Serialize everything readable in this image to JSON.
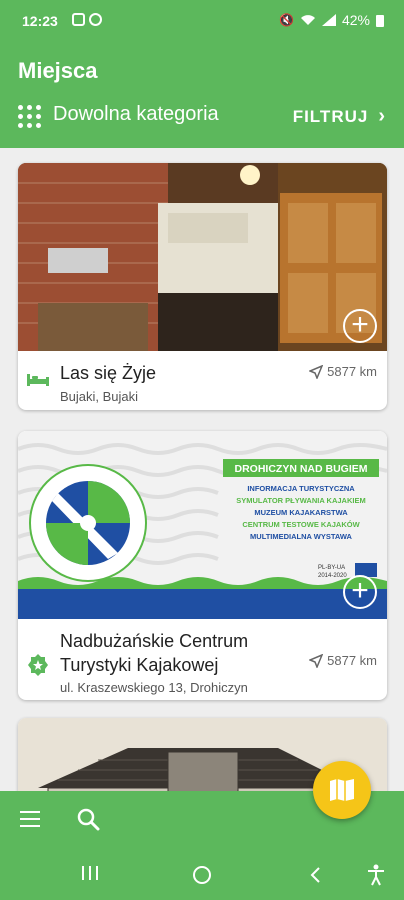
{
  "status": {
    "time": "12:23",
    "battery": "42%"
  },
  "header": {
    "title": "Miejsca",
    "category": "Dowolna kategoria",
    "filter_label": "FILTRUJ"
  },
  "places": [
    {
      "name": "Las się Żyje",
      "address": "Bujaki, Bujaki",
      "distance": "5877 km",
      "type_icon": "bed-icon"
    },
    {
      "name": "Nadbużańskie Centrum Turystyki Kajakowej",
      "address": "ul. Kraszewskiego 13, Drohiczyn",
      "distance": "5877 km",
      "type_icon": "star-badge-icon",
      "poster": {
        "ring_text": "Nadbużańskie Centrum Turystyki Kajakowej",
        "headline": "DROHICZYN NAD BUGIEM",
        "lines": [
          "INFORMACJA TURYSTYCZNA",
          "SYMULATOR PŁYWANIA KAJAKIEM",
          "MUZEUM KAJAKARSTWA",
          "CENTRUM TESTOWE KAJAKÓW",
          "MULTIMEDIALNA WYSTAWA"
        ],
        "program": "PL-BY-UA",
        "years": "2014-2020"
      }
    }
  ],
  "colors": {
    "primary": "#5cb85c",
    "fab": "#f5c518",
    "poster_blue": "#1f4fa3",
    "poster_green": "#58b947"
  }
}
